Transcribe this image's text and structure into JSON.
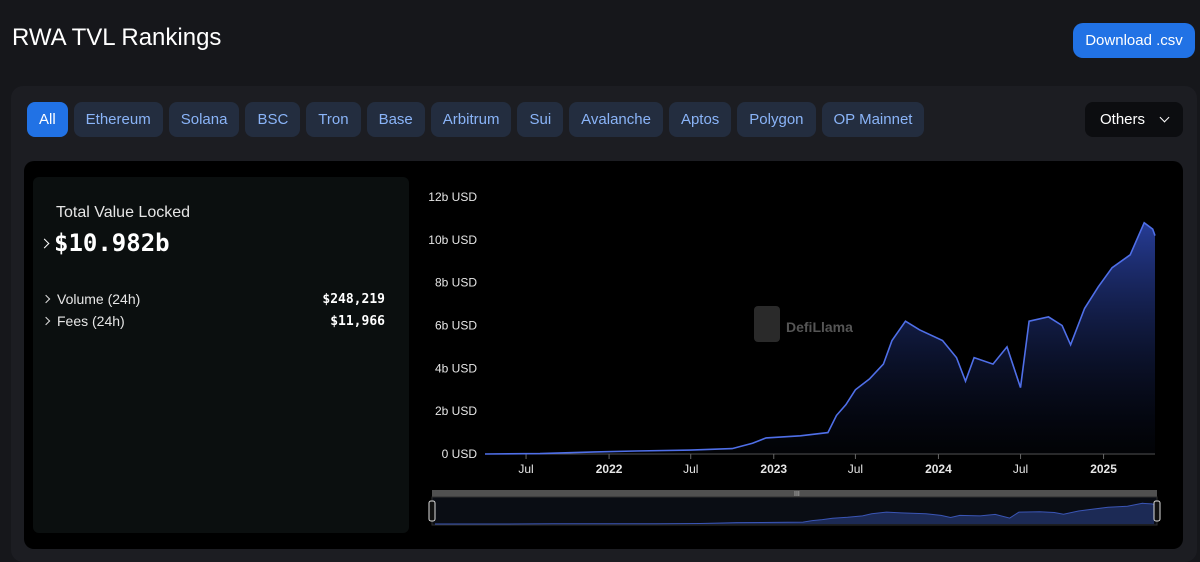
{
  "header": {
    "title": "RWA TVL Rankings",
    "download_label": "Download .csv"
  },
  "chains": {
    "tabs": [
      "All",
      "Ethereum",
      "Solana",
      "BSC",
      "Tron",
      "Base",
      "Arbitrum",
      "Sui",
      "Avalanche",
      "Aptos",
      "Polygon",
      "OP Mainnet"
    ],
    "active": "All",
    "others_label": "Others"
  },
  "stats": {
    "tvl_label": "Total Value Locked",
    "tvl_value": "$10.982b",
    "volume_label": "Volume (24h)",
    "volume_value": "$248,219",
    "fees_label": "Fees (24h)",
    "fees_value": "$11,966"
  },
  "watermark": "DefiLlama",
  "colors": {
    "accent": "#2172e5",
    "line": "#4f6fe8",
    "tab_bg": "#232d3f",
    "tab_text": "#8ab4f8"
  },
  "chart_data": {
    "type": "area",
    "title": "",
    "xlabel": "",
    "ylabel": "",
    "yunit": "b USD",
    "ylim": [
      0,
      12
    ],
    "yticks": [
      0,
      2,
      4,
      6,
      8,
      10,
      12
    ],
    "ytick_labels": [
      "0 USD",
      "2b USD",
      "4b USD",
      "6b USD",
      "8b USD",
      "10b USD",
      "12b USD"
    ],
    "xlim": [
      "2021-04-01",
      "2025-04-25"
    ],
    "xticks": [
      {
        "date": "2021-07-01",
        "label": "Jul",
        "bold": false
      },
      {
        "date": "2022-01-01",
        "label": "2022",
        "bold": true
      },
      {
        "date": "2022-07-01",
        "label": "Jul",
        "bold": false
      },
      {
        "date": "2023-01-01",
        "label": "2023",
        "bold": true
      },
      {
        "date": "2023-07-01",
        "label": "Jul",
        "bold": false
      },
      {
        "date": "2024-01-01",
        "label": "2024",
        "bold": true
      },
      {
        "date": "2024-07-01",
        "label": "Jul",
        "bold": false
      },
      {
        "date": "2025-01-01",
        "label": "2025",
        "bold": true
      }
    ],
    "series": [
      {
        "name": "",
        "points": [
          [
            "2021-04-01",
            0.0
          ],
          [
            "2021-08-01",
            0.02
          ],
          [
            "2021-12-01",
            0.1
          ],
          [
            "2022-03-01",
            0.14
          ],
          [
            "2022-07-01",
            0.18
          ],
          [
            "2022-10-01",
            0.25
          ],
          [
            "2022-11-15",
            0.5
          ],
          [
            "2022-12-15",
            0.75
          ],
          [
            "2023-03-01",
            0.85
          ],
          [
            "2023-05-01",
            1.0
          ],
          [
            "2023-05-20",
            1.8
          ],
          [
            "2023-06-10",
            2.3
          ],
          [
            "2023-07-01",
            3.0
          ],
          [
            "2023-08-01",
            3.5
          ],
          [
            "2023-09-01",
            4.2
          ],
          [
            "2023-09-20",
            5.3
          ],
          [
            "2023-10-20",
            6.2
          ],
          [
            "2023-11-20",
            5.8
          ],
          [
            "2024-01-10",
            5.3
          ],
          [
            "2024-02-10",
            4.5
          ],
          [
            "2024-03-01",
            3.4
          ],
          [
            "2024-03-20",
            4.5
          ],
          [
            "2024-05-01",
            4.2
          ],
          [
            "2024-06-01",
            5.0
          ],
          [
            "2024-07-01",
            3.1
          ],
          [
            "2024-07-20",
            6.2
          ],
          [
            "2024-09-01",
            6.4
          ],
          [
            "2024-10-01",
            6.0
          ],
          [
            "2024-10-20",
            5.1
          ],
          [
            "2024-11-20",
            6.8
          ],
          [
            "2024-12-20",
            7.8
          ],
          [
            "2025-01-20",
            8.7
          ],
          [
            "2025-03-01",
            9.3
          ],
          [
            "2025-04-01",
            10.8
          ],
          [
            "2025-04-20",
            10.5
          ],
          [
            "2025-04-25",
            10.2
          ]
        ]
      }
    ],
    "grid": false,
    "legend": "none"
  }
}
